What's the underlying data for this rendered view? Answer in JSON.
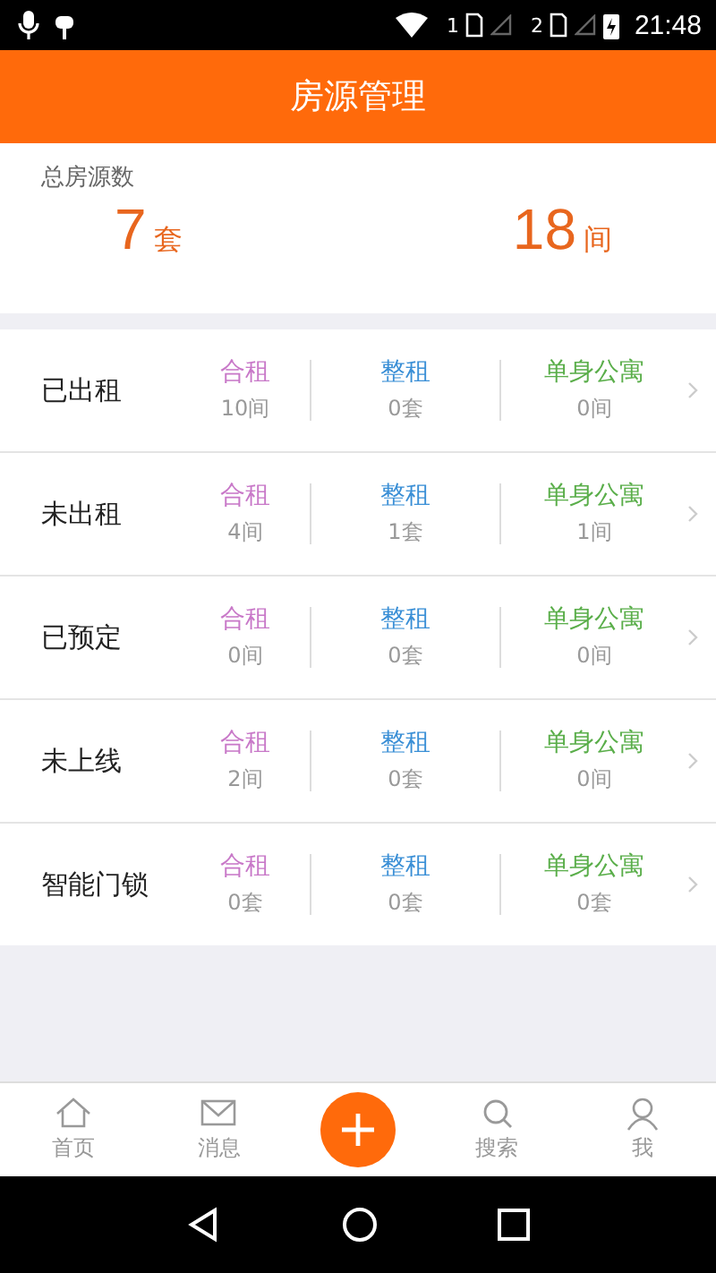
{
  "status_bar": {
    "sim_1": "1",
    "sim_2": "2",
    "time": "21:48"
  },
  "header": {
    "title": "房源管理"
  },
  "summary": {
    "label": "总房源数",
    "totals": [
      {
        "value": "7",
        "unit": "套"
      },
      {
        "value": "18",
        "unit": "间"
      }
    ]
  },
  "rows": [
    {
      "label": "已出租",
      "cells": [
        {
          "kind": "shared",
          "type": "合租",
          "count": "10间"
        },
        {
          "kind": "whole",
          "type": "整租",
          "count": "0套"
        },
        {
          "kind": "single",
          "type": "单身公寓",
          "count": "0间"
        }
      ]
    },
    {
      "label": "未出租",
      "cells": [
        {
          "kind": "shared",
          "type": "合租",
          "count": "4间"
        },
        {
          "kind": "whole",
          "type": "整租",
          "count": "1套"
        },
        {
          "kind": "single",
          "type": "单身公寓",
          "count": "1间"
        }
      ]
    },
    {
      "label": "已预定",
      "cells": [
        {
          "kind": "shared",
          "type": "合租",
          "count": "0间"
        },
        {
          "kind": "whole",
          "type": "整租",
          "count": "0套"
        },
        {
          "kind": "single",
          "type": "单身公寓",
          "count": "0间"
        }
      ]
    },
    {
      "label": "未上线",
      "cells": [
        {
          "kind": "shared",
          "type": "合租",
          "count": "2间"
        },
        {
          "kind": "whole",
          "type": "整租",
          "count": "0套"
        },
        {
          "kind": "single",
          "type": "单身公寓",
          "count": "0间"
        }
      ]
    },
    {
      "label": "智能门锁",
      "cells": [
        {
          "kind": "shared",
          "type": "合租",
          "count": "0套"
        },
        {
          "kind": "whole",
          "type": "整租",
          "count": "0套"
        },
        {
          "kind": "single",
          "type": "单身公寓",
          "count": "0套"
        }
      ]
    }
  ],
  "tab_bar": [
    {
      "kind": "home",
      "label": "首页"
    },
    {
      "kind": "message",
      "label": "消息"
    },
    {
      "kind": "add"
    },
    {
      "kind": "search",
      "label": "搜索"
    },
    {
      "kind": "me",
      "label": "我"
    }
  ]
}
